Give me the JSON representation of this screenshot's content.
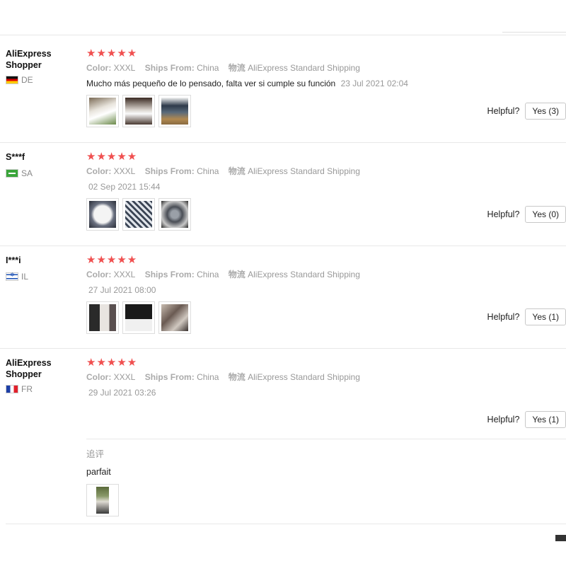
{
  "labels": {
    "color_label": "Color:",
    "ships_label": "Ships From:",
    "shipping_label": "物流",
    "helpful_label": "Helpful?",
    "followup_label": "追评"
  },
  "reviews": [
    {
      "user": "AliExpress Shopper",
      "country": "DE",
      "stars": "★★★★★",
      "color": "XXXL",
      "ships_from": "China",
      "shipping": "AliExpress Standard Shipping",
      "text": "Mucho más pequeño de lo pensado, falta ver si cumple su función",
      "date": "23 Jul 2021 02:04",
      "helpful_button": "Yes (3)"
    },
    {
      "user": "S***f",
      "country": "SA",
      "stars": "★★★★★",
      "color": "XXXL",
      "ships_from": "China",
      "shipping": "AliExpress Standard Shipping",
      "date": "02 Sep 2021 15:44",
      "helpful_button": "Yes (0)"
    },
    {
      "user": "I***i",
      "country": "IL",
      "stars": "★★★★★",
      "color": "XXXL",
      "ships_from": "China",
      "shipping": "AliExpress Standard Shipping",
      "date": "27 Jul 2021 08:00",
      "helpful_button": "Yes (1)"
    },
    {
      "user": "AliExpress Shopper",
      "country": "FR",
      "stars": "★★★★★",
      "color": "XXXL",
      "ships_from": "China",
      "shipping": "AliExpress Standard Shipping",
      "date": "29 Jul 2021 03:26",
      "helpful_button": "Yes (1)",
      "followup_text": "parfait"
    }
  ]
}
